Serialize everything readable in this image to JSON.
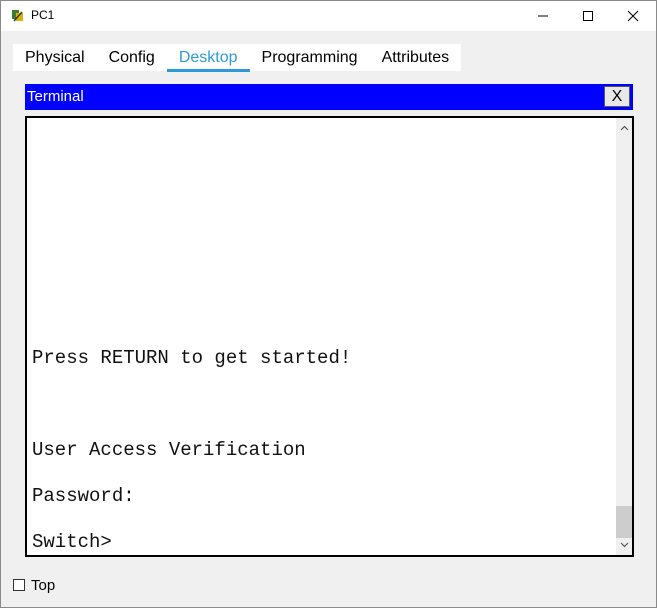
{
  "window": {
    "title": "PC1"
  },
  "tabs": [
    {
      "label": "Physical"
    },
    {
      "label": "Config"
    },
    {
      "label": "Desktop"
    },
    {
      "label": "Programming"
    },
    {
      "label": "Attributes"
    }
  ],
  "active_tab": "Desktop",
  "terminal": {
    "title": "Terminal",
    "close_label": "X",
    "lines": [
      "Press RETURN to get started!",
      "User Access Verification",
      "Password:",
      "Switch>"
    ]
  },
  "footer": {
    "top_label": "Top",
    "top_checked": false
  },
  "colors": {
    "accent": "#2d9ad8",
    "terminal_header": "#0000ff"
  }
}
